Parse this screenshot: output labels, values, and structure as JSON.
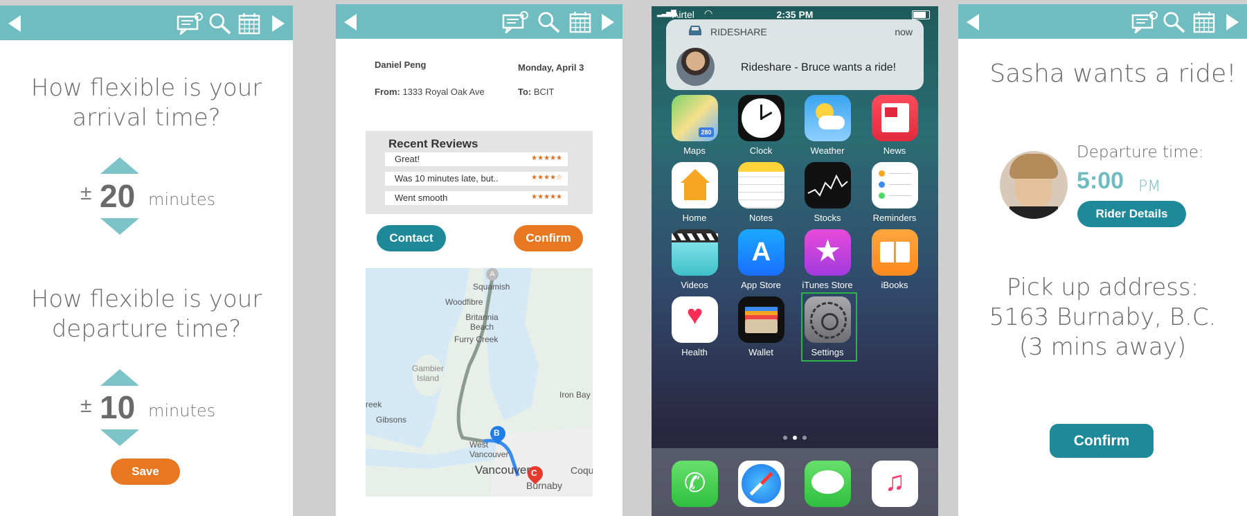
{
  "screen1": {
    "arrival_question": "How flexible is your arrival time?",
    "arrival_pm": "±",
    "arrival_value": "20",
    "arrival_unit": "minutes",
    "departure_question": "How flexible is your departure time?",
    "departure_pm": "±",
    "departure_value": "10",
    "departure_unit": "minutes",
    "save_label": "Save"
  },
  "screen2": {
    "driver_name": "Daniel Peng",
    "date": "Monday, April 3",
    "from_label": "From:",
    "from_value": "1333 Royal Oak Ave",
    "to_label": "To:",
    "to_value": "BCIT",
    "reviews_title": "Recent Reviews",
    "reviews": [
      {
        "text": "Great!",
        "stars": "★★★★★"
      },
      {
        "text": "Was 10 minutes late, but..",
        "stars": "★★★★☆"
      },
      {
        "text": "Went smooth",
        "stars": "★★★★★"
      }
    ],
    "contact_label": "Contact",
    "confirm_label": "Confirm",
    "map": {
      "places": [
        "Squamish",
        "Woodfibre",
        "Britannia Beach",
        "Furry Creek",
        "Gambier Island",
        "Iron Bay",
        "reek",
        "Gibsons",
        "West Vancouver",
        "Vancouver",
        "Burnaby",
        "Coqu"
      ],
      "markers": [
        "A",
        "B",
        "C"
      ]
    }
  },
  "screen3": {
    "carrier": "Airtel",
    "time": "2:35 PM",
    "notification": {
      "app": "RIDESHARE",
      "when": "now",
      "message": "Rideshare - Bruce wants a ride!"
    },
    "apps": [
      "Maps",
      "Clock",
      "Weather",
      "News",
      "Home",
      "Notes",
      "Stocks",
      "Reminders",
      "Videos",
      "App Store",
      "iTunes Store",
      "iBooks",
      "Health",
      "Wallet",
      "Settings"
    ],
    "map_badge": "280",
    "highlight_color": "#2db34a"
  },
  "screen4": {
    "title": "Sasha wants a ride!",
    "departure_label": "Departure time:",
    "departure_time": "5:00",
    "departure_ampm": "PM",
    "rider_details_label": "Rider Details",
    "pickup_line1": "Pick up address:",
    "pickup_line2": "5163 Burnaby, B.C.",
    "pickup_line3": "(3 mins away)",
    "confirm_label": "Confirm"
  },
  "colors": {
    "topbar": "#6fbcc1",
    "teal_button": "#1e8a99",
    "orange_button": "#e87722",
    "accent_text": "#6fbcc1"
  }
}
